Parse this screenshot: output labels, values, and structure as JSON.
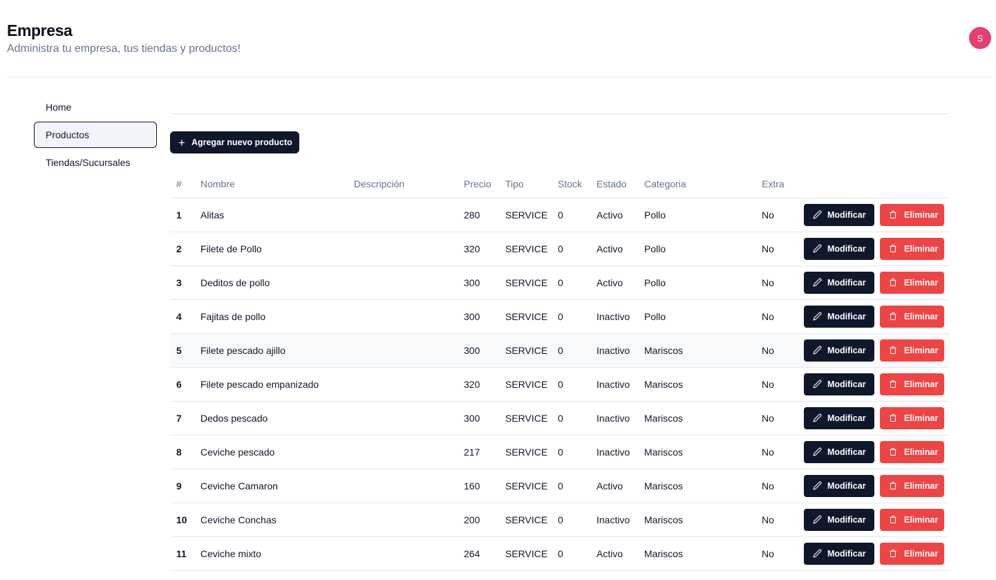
{
  "header": {
    "title": "Empresa",
    "subtitle": "Administra tu empresa, tus tiendas y productos!",
    "avatar_letter": "S"
  },
  "sidebar": {
    "items": [
      {
        "label": "Home"
      },
      {
        "label": "Productos",
        "active": true
      },
      {
        "label": "Tiendas/Sucursales"
      }
    ]
  },
  "toolbar": {
    "add_label": "Agregar nuevo producto"
  },
  "table": {
    "columns": [
      "#",
      "Nombre",
      "Descripción",
      "Precio",
      "Tipo",
      "Stock",
      "Estado",
      "Categoria",
      "Extra"
    ],
    "edit_label": "Modificar",
    "delete_label": "Eliminar",
    "rows": [
      {
        "id": "1",
        "name": "Alitas",
        "description": "",
        "price": "280",
        "type": "SERVICE",
        "stock": "0",
        "status": "Activo",
        "category": "Pollo",
        "extra": "No"
      },
      {
        "id": "2",
        "name": "Filete de Pollo",
        "description": "",
        "price": "320",
        "type": "SERVICE",
        "stock": "0",
        "status": "Activo",
        "category": "Pollo",
        "extra": "No"
      },
      {
        "id": "3",
        "name": "Deditos de pollo",
        "description": "",
        "price": "300",
        "type": "SERVICE",
        "stock": "0",
        "status": "Activo",
        "category": "Pollo",
        "extra": "No"
      },
      {
        "id": "4",
        "name": "Fajitas de pollo",
        "description": "",
        "price": "300",
        "type": "SERVICE",
        "stock": "0",
        "status": "Inactivo",
        "category": "Pollo",
        "extra": "No"
      },
      {
        "id": "5",
        "name": "Filete pescado ajillo",
        "description": "",
        "price": "300",
        "type": "SERVICE",
        "stock": "0",
        "status": "Inactivo",
        "category": "Mariscos",
        "extra": "No",
        "highlighted": true
      },
      {
        "id": "6",
        "name": "Filete pescado empanizado",
        "description": "",
        "price": "320",
        "type": "SERVICE",
        "stock": "0",
        "status": "Inactivo",
        "category": "Mariscos",
        "extra": "No"
      },
      {
        "id": "7",
        "name": "Dedos pescado",
        "description": "",
        "price": "300",
        "type": "SERVICE",
        "stock": "0",
        "status": "Inactivo",
        "category": "Mariscos",
        "extra": "No"
      },
      {
        "id": "8",
        "name": "Ceviche pescado",
        "description": "",
        "price": "217",
        "type": "SERVICE",
        "stock": "0",
        "status": "Inactivo",
        "category": "Mariscos",
        "extra": "No"
      },
      {
        "id": "9",
        "name": "Ceviche Camaron",
        "description": "",
        "price": "160",
        "type": "SERVICE",
        "stock": "0",
        "status": "Activo",
        "category": "Mariscos",
        "extra": "No"
      },
      {
        "id": "10",
        "name": "Ceviche Conchas",
        "description": "",
        "price": "200",
        "type": "SERVICE",
        "stock": "0",
        "status": "Inactivo",
        "category": "Mariscos",
        "extra": "No"
      },
      {
        "id": "11",
        "name": "Ceviche mixto",
        "description": "",
        "price": "264",
        "type": "SERVICE",
        "stock": "0",
        "status": "Activo",
        "category": "Mariscos",
        "extra": "No"
      }
    ]
  },
  "icons": {
    "add": "plus-icon",
    "edit": "pencil-icon",
    "delete": "trash-icon"
  },
  "colors": {
    "primary": "#0f172a",
    "danger": "#ef4444",
    "avatar": "#e63f71",
    "muted_text": "#64748b",
    "border": "#e2e8f0"
  }
}
